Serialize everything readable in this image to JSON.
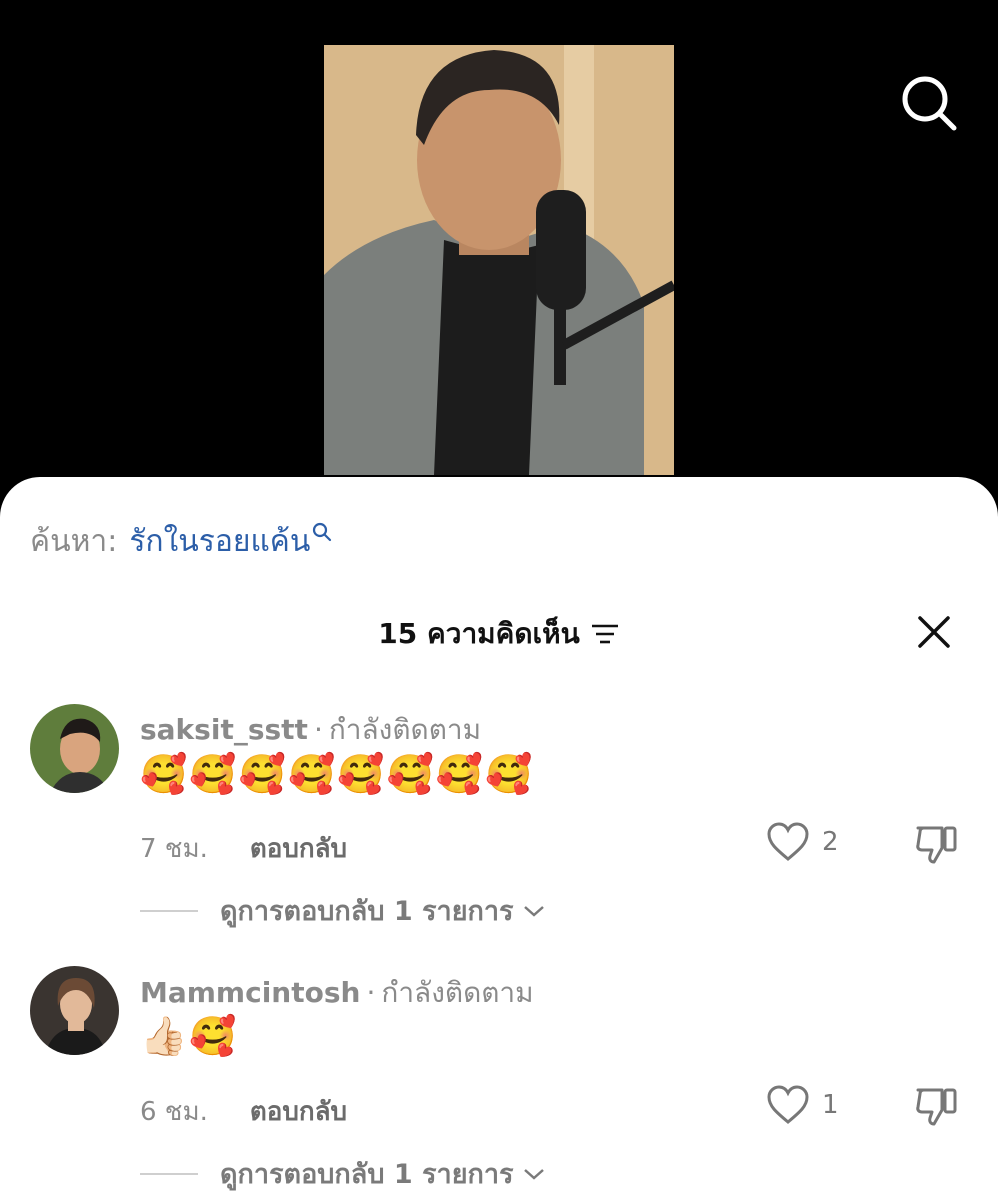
{
  "video": {
    "thumbnail": "man-with-microphone-thumbnail"
  },
  "search": {
    "prefix": "ค้นหา:",
    "query": "รักในรอยแค้น"
  },
  "comments_header": {
    "title": "15 ความคิดเห็น"
  },
  "comments": [
    {
      "username": "saksit_sstt",
      "follow_status": "กำลังติดตาม",
      "content": "🥰🥰🥰🥰🥰🥰🥰🥰",
      "time": "7 ชม.",
      "reply_label": "ตอบกลับ",
      "likes": "2",
      "view_replies": "ดูการตอบกลับ 1 รายการ"
    },
    {
      "username": "Mammcintosh",
      "follow_status": "กำลังติดตาม",
      "content": "👍🏻🥰",
      "time": "6 ชม.",
      "reply_label": "ตอบกลับ",
      "likes": "1",
      "view_replies": "ดูการตอบกลับ 1 รายการ"
    }
  ],
  "colors": {
    "search_query": "#2c5ea8",
    "secondary_text": "#8a8a8a",
    "background_dark": "#000000"
  },
  "icons": [
    "search-icon",
    "filter-icon",
    "close-icon",
    "heart-icon",
    "dislike-icon",
    "chevron-down-icon"
  ]
}
